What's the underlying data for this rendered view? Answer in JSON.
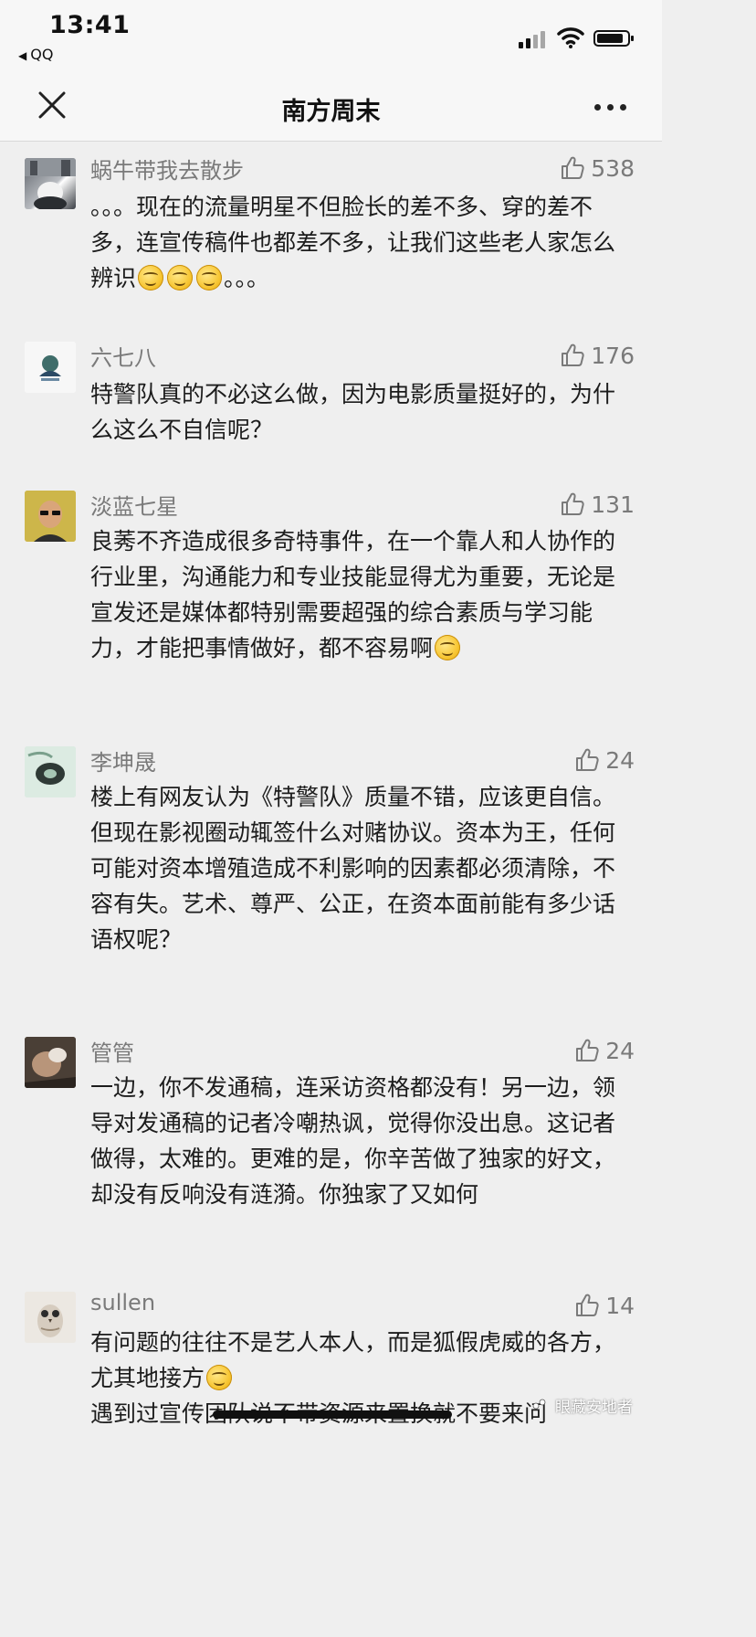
{
  "status_bar": {
    "time": "13:41",
    "back_app": "QQ",
    "icons": [
      "signal-icon",
      "wifi-icon",
      "battery-icon"
    ]
  },
  "nav": {
    "title": "南方周末",
    "left_icon": "close-icon",
    "right_icon": "more-icon"
  },
  "comments": [
    {
      "name": "蜗牛带我去散步",
      "likes": "538",
      "lines": [
        {
          "text": "。。。现在的流量明星不但脸长的差不多、穿的差不多，连宣传稿件也都差不多，让我们这些老人家怎么辨识",
          "emoji_after": 3,
          "tail": "。。。"
        }
      ]
    },
    {
      "name": "六七八",
      "likes": "176",
      "lines": [
        {
          "text": "特警队真的不必这么做，因为电影质量挺好的，为什么这么不自信呢？",
          "emoji_after": 0,
          "tail": ""
        }
      ]
    },
    {
      "name": "淡蓝七星",
      "likes": "131",
      "lines": [
        {
          "text": "良莠不齐造成很多奇特事件，在一个靠人和人协作的行业里，沟通能力和专业技能显得尤为重要，无论是宣发还是媒体都特别需要超强的综合素质与学习能力，才能把事情做好，都不容易啊",
          "emoji_after": 1,
          "tail": ""
        }
      ]
    },
    {
      "name": "李坤晟",
      "likes": "24",
      "lines": [
        {
          "text": "楼上有网友认为《特警队》质量不错，应该更自信。",
          "emoji_after": 0,
          "tail": ""
        },
        {
          "text": "但现在影视圈动辄签什么对赌协议。资本为王，任何可能对资本增殖造成不利影响的因素都必须清除，不容有失。艺术、尊严、公正，在资本面前能有多少话语权呢？",
          "emoji_after": 0,
          "tail": ""
        }
      ]
    },
    {
      "name": "管管",
      "likes": "24",
      "lines": [
        {
          "text": "一边，你不发通稿，连采访资格都没有！另一边，领导对发通稿的记者冷嘲热讽，觉得你没出息。这记者做得，太难的。更难的是，你辛苦做了独家的好文，却没有反响没有涟漪。你独家了又如何",
          "emoji_after": 0,
          "tail": ""
        }
      ]
    },
    {
      "name": "sullen",
      "likes": "14",
      "lines": [
        {
          "text": "有问题的往往不是艺人本人，而是狐假虎威的各方，尤其地接方",
          "emoji_after": 1,
          "tail": ""
        },
        {
          "text": "遇到过宣传团队说不带资源来置换就不要来问",
          "emoji_after": 0,
          "tail": ""
        }
      ]
    }
  ],
  "watermark": "眼藏安地者"
}
